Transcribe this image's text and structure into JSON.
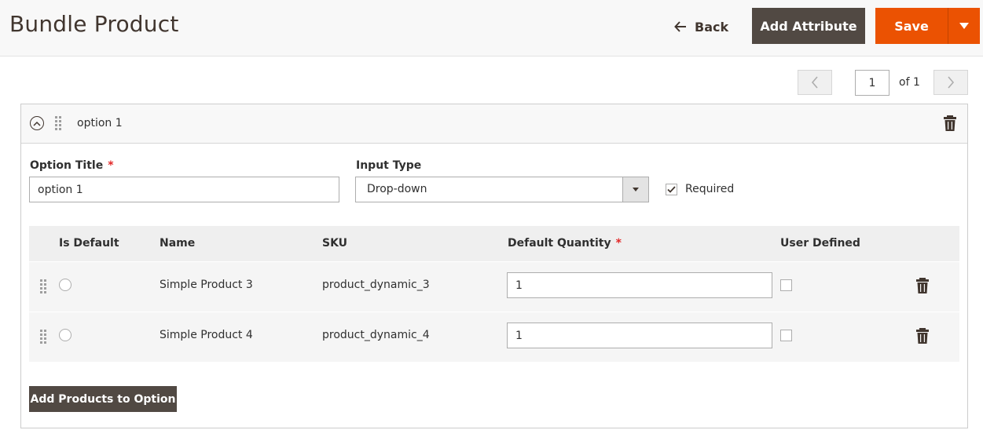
{
  "header": {
    "title": "Bundle Product",
    "back_label": "Back",
    "add_attribute_label": "Add Attribute",
    "save_label": "Save"
  },
  "pager": {
    "current_page": "1",
    "of_label": "of 1"
  },
  "option": {
    "name": "option 1",
    "title_label": "Option Title",
    "title_value": "option 1",
    "input_type_label": "Input Type",
    "input_type_value": "Drop-down",
    "required_label": "Required",
    "required_checked": true,
    "add_products_label": "Add Products to Option"
  },
  "grid": {
    "columns": [
      "Is Default",
      "Name",
      "SKU",
      "Default Quantity",
      "User Defined"
    ],
    "rows": [
      {
        "name": "Simple Product 3",
        "sku": "product_dynamic_3",
        "quantity": "1",
        "user_defined": false,
        "is_default": false
      },
      {
        "name": "Simple Product 4",
        "sku": "product_dynamic_4",
        "quantity": "1",
        "user_defined": false,
        "is_default": false
      }
    ]
  },
  "colors": {
    "accent": "#eb5202",
    "dark_button": "#514943",
    "required_star": "#e22626"
  },
  "icons": [
    "back-arrow-icon",
    "chevron-down-icon",
    "chevron-left-icon",
    "chevron-right-icon",
    "collapse-icon",
    "drag-handle-icon",
    "trash-icon"
  ]
}
